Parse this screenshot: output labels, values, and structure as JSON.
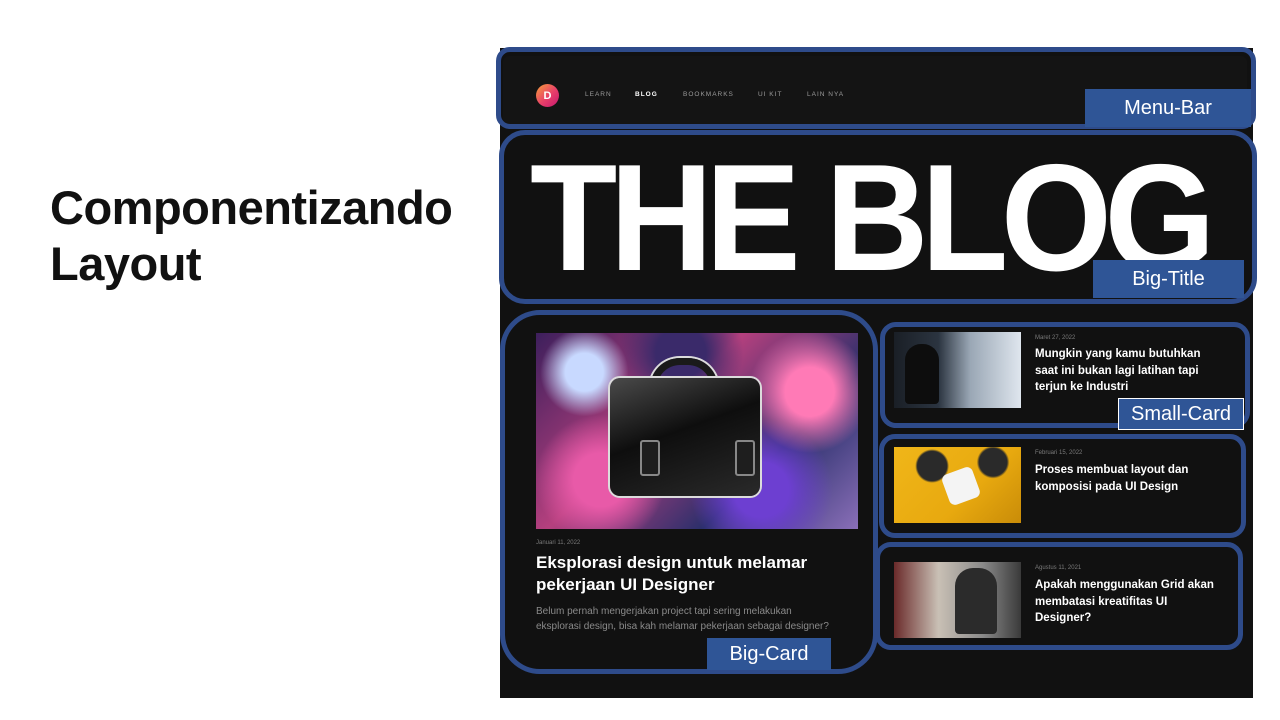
{
  "slide": {
    "title_line1": "Componentizando",
    "title_line2": "Layout"
  },
  "mockup": {
    "logo_letter": "D",
    "nav": [
      {
        "label": "LEARN",
        "active": false
      },
      {
        "label": "BLOG",
        "active": true
      },
      {
        "label": "BOOKMARKS",
        "active": false
      },
      {
        "label": "UI KIT",
        "active": false
      },
      {
        "label": "LAIN NYA",
        "active": false
      }
    ],
    "big_title": "THE BLOG",
    "big_card": {
      "date": "Januari 11, 2022",
      "title": "Eksplorasi design untuk melamar pekerjaan UI Designer",
      "description": "Belum pernah mengerjakan project tapi sering melakukan eksplorasi design, bisa kah melamar pekerjaan sebagai designer?"
    },
    "small_cards": [
      {
        "date": "Maret 27, 2022",
        "title": "Mungkin yang kamu butuhkan saat ini bukan lagi latihan tapi terjun ke Industri"
      },
      {
        "date": "Februari 15, 2022",
        "title": "Proses membuat layout dan komposisi pada UI Design"
      },
      {
        "date": "Agustus 11, 2021",
        "title": "Apakah menggunakan Grid akan membatasi kreatifitas UI Designer?"
      }
    ]
  },
  "labels": {
    "menu_bar": "Menu-Bar",
    "big_title": "Big-Title",
    "small_card": "Small-Card",
    "big_card": "Big-Card"
  },
  "colors": {
    "outline": "#2e4b8a",
    "label_bg": "#2f5596",
    "mockup_bg": "#111111",
    "logo_gradient": [
      "#f6a13a",
      "#e83e6a",
      "#c4176f"
    ]
  }
}
